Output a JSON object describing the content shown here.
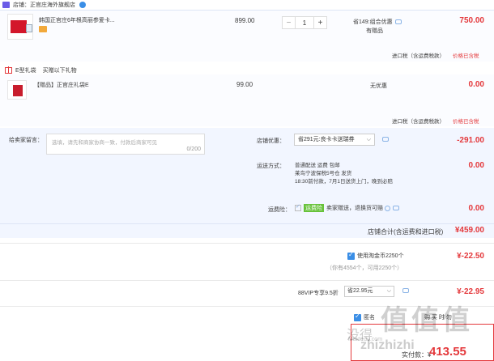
{
  "shop": {
    "name": "店铺：正官庄海外旗舰店"
  },
  "items": [
    {
      "name": "韩国正官庄6年根高丽参爱卡...",
      "price": "899.00",
      "quantity": "1",
      "promo_line1": "省149:组合优惠",
      "promo_line2": "有赠品",
      "subtotal": "750.00",
      "tax_text": "进口税（含运费税款）",
      "tax_link": "价格已含税"
    },
    {
      "name": "【赠品】正官庄礼袋E",
      "price": "99.00",
      "promo": "无优惠",
      "subtotal": "0.00",
      "tax_text": "进口税（含运费税款）",
      "tax_link": "价格已含税"
    }
  ],
  "gift": {
    "label": "E型礼袋",
    "note": "买赠以下礼物"
  },
  "stepper": {
    "minus": "−",
    "plus": "+"
  },
  "message": {
    "label": "给卖家留言：",
    "placeholder": "选填，请先和商家协商一致，付款后商家可见",
    "count": "0/200"
  },
  "shop_discount": {
    "label": "店铺优惠：",
    "selected": "省291元:良卡卡送瑞券",
    "value": "-291.00"
  },
  "shipping": {
    "label": "运送方式：",
    "line1": "普通配送  运费  包邮",
    "line2": "莱鸟宁波保税5号仓  发货",
    "line3": "18:30前付款，7月1日送货上门，晚到必赔",
    "value": "0.00"
  },
  "insurance": {
    "label": "运费险：",
    "tag": "运费险",
    "text": "卖家赠送，退换货可赔",
    "value": "0.00"
  },
  "shop_total": {
    "label": "店铺合计(含运费和进口税)",
    "value": "¥459.00"
  },
  "coins": {
    "label": "使用淘金币2250个",
    "sub": "（你有4554个，可用2250个）",
    "value": "¥-22.50"
  },
  "vip": {
    "label": "88VIP专享9.5折",
    "selected": "省22.95元",
    "value": "¥-22.95"
  },
  "anon": {
    "label": "匿名",
    "extra": "购 买 时 勿"
  },
  "pay": {
    "label": "实付款：¥",
    "value": "413.55"
  },
  "watermark": {
    "big": "值值值",
    "line1": "没得",
    "line2": "zhizhizhi",
    "site": "Maidedu.com"
  },
  "colors": {
    "accent": "#e4393c",
    "blue": "#3a8ee6",
    "section_bg": "#f2f6ff"
  }
}
